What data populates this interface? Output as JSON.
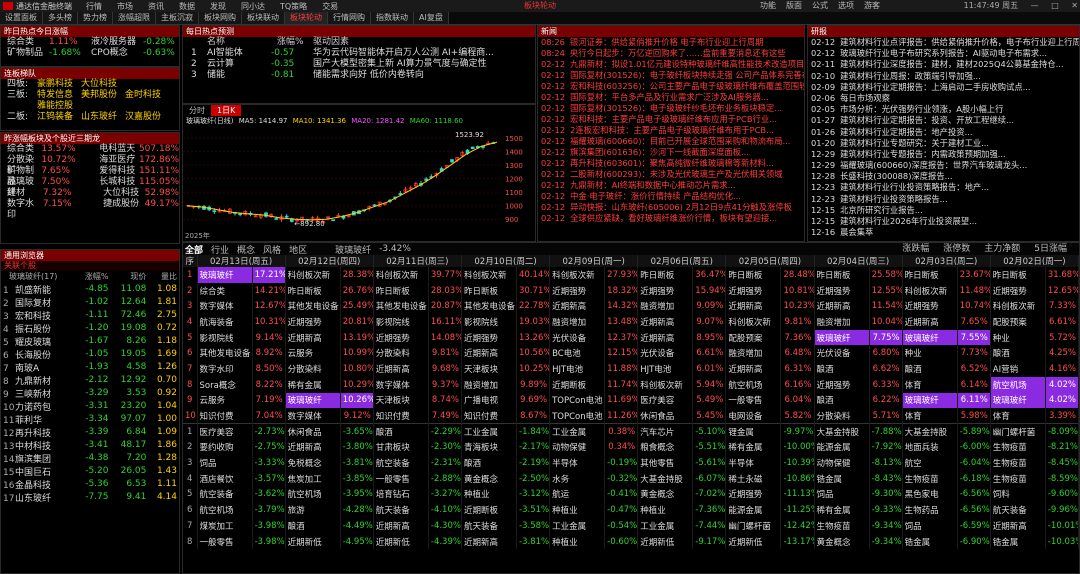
{
  "titlebar": {
    "app": "通达信金融终端",
    "menu": [
      "行情",
      "市场",
      "资讯",
      "数据",
      "发现",
      "同小达",
      "TQ策略",
      "交易"
    ],
    "center": "板块轮动",
    "right": [
      "功能",
      "版面",
      "公式",
      "选项",
      "游客"
    ],
    "time": "11:47:49 周五"
  },
  "tabs": [
    "设置面板",
    "多头榜",
    "势力榜",
    "涨幅超限",
    "主板沉寂",
    "板块网购",
    "板块联动",
    "板块轮动",
    "行情网购",
    "指数联动",
    "AI复盘"
  ],
  "active_tab": "板块轮动",
  "hot": {
    "title": "昨日热点今日涨幅",
    "rows": [
      [
        "综合类",
        "1.11%",
        "液冷服务器",
        "-0.28%"
      ],
      [
        "矿物制品",
        "-1.68%",
        "CPO概念",
        "-0.63%"
      ]
    ]
  },
  "conc": {
    "title": "连板梯队",
    "rows": [
      [
        "四板:",
        "豪鹏科技",
        "大位科技",
        ""
      ],
      [
        "三板:",
        "特发信息",
        "美邦股份",
        "金时科技"
      ],
      [
        "",
        "雅能控股",
        "",
        ""
      ],
      [
        "二板:",
        "江钨装备",
        "山东玻纤",
        "汉嘉股份"
      ]
    ]
  },
  "dragon": {
    "title": "昨涨幅板块及个股近三期龙",
    "rows": [
      [
        "综合类",
        "13.57%",
        "电科蓝天",
        "507.18%"
      ],
      [
        "分散染料",
        "10.72%",
        "海亚医疗",
        "172.86%"
      ],
      [
        "矿物制品",
        "7.65%",
        "爱得科技",
        "151.11%"
      ],
      [
        "玻璃玻纤",
        "7.50%",
        "长城科技",
        "115.05%"
      ],
      [
        "建材",
        "7.32%",
        "大位科技",
        "52.98%"
      ],
      [
        "数字水印",
        "7.15%",
        "捷成股份",
        "49.17%"
      ]
    ]
  },
  "watch": {
    "title": "通用浏览器",
    "sub": "关联个股",
    "headers": [
      "玻璃玻纤(17)",
      "涨幅%",
      "现价",
      "量比"
    ],
    "rows": [
      [
        "1",
        "凯盛新能",
        "-4.85",
        "11.08",
        "1.08"
      ],
      [
        "2",
        "国际复材",
        "-1.02",
        "12.64",
        "1.81"
      ],
      [
        "3",
        "宏和科技",
        "-1.11",
        "72.46",
        "2.75"
      ],
      [
        "4",
        "振石股份",
        "-1.20",
        "19.08",
        "0.72"
      ],
      [
        "5",
        "耀皮玻璃",
        "-1.67",
        "8.26",
        "1.18"
      ],
      [
        "6",
        "长海股份",
        "-1.05",
        "19.05",
        "1.69"
      ],
      [
        "7",
        "南玻A",
        "-1.93",
        "4.58",
        "1.26"
      ],
      [
        "8",
        "九鼎新材",
        "-2.12",
        "12.92",
        "0.70"
      ],
      [
        "9",
        "三峡新材",
        "-3.29",
        "3.53",
        "0.92"
      ],
      [
        "10",
        "力诺药包",
        "-3.31",
        "23.20",
        "1.04"
      ],
      [
        "11",
        "菲利华",
        "-3.34",
        "97.07",
        "1.00"
      ],
      [
        "12",
        "再升科技",
        "-3.39",
        "6.84",
        "1.09"
      ],
      [
        "13",
        "中材科技",
        "-3.41",
        "48.17",
        "1.86"
      ],
      [
        "14",
        "旗滨集团",
        "-4.38",
        "7.20",
        "1.28"
      ],
      [
        "15",
        "中国巨石",
        "-5.20",
        "26.05",
        "1.43"
      ],
      [
        "16",
        "金晶科技",
        "-5.36",
        "6.53",
        "1.11"
      ],
      [
        "17",
        "山东玻纤",
        "-7.75",
        "9.41",
        "4.14"
      ]
    ]
  },
  "theme": {
    "title": "每日热点预测",
    "headers": [
      "名称",
      "涨幅%",
      "驱动因素"
    ],
    "rows": [
      [
        "1",
        "AI智能体",
        "-0.57",
        "华为云代码智能体开启万人公测 AI+编程商..."
      ],
      [
        "2",
        "云计算",
        "-0.35",
        "国产大模型密集上新 AI算力景气度与确定性"
      ],
      [
        "3",
        "储能",
        "-0.81",
        "储能需求向好 低价内卷转向"
      ]
    ]
  },
  "chart_tabs": [
    "分时",
    "1日K"
  ],
  "chart_legend": {
    "name": "玻璃玻纤(日线)",
    "ma5": "MA5: 1414.97",
    "ma10": "MA10: 1341.36",
    "ma20": "MA20: 1281.42",
    "ma60": "MA60: 1118.60"
  },
  "chart_data": {
    "type": "line",
    "title": "玻璃玻纤(日线)",
    "series": [
      {
        "name": "MA5",
        "values": [
          1000,
          990,
          970,
          950,
          940,
          930,
          910,
          900,
          895,
          900,
          920,
          950,
          990,
          1030,
          1090,
          1150,
          1220,
          1300,
          1380,
          1440,
          1470
        ]
      }
    ],
    "high_label": "1523.92",
    "low_label": "892.80",
    "yaxis": [
      "1500",
      "1400",
      "1300",
      "1200",
      "1100",
      "1000",
      "900"
    ],
    "xlabel": "2025年"
  },
  "news": {
    "title": "新闻",
    "rows": [
      [
        "08:26",
        "银河证券：供给紧俏推升价格 电子布行业迎上行周期"
      ],
      [
        "08:24",
        "央行今日起步：万亿逆回购来了……盘前重要消息还有这些"
      ],
      [
        "02-12",
        "九鼎新材：拟设1.01亿元建设特种玻璃纤维高性能技术改造项目"
      ],
      [
        "02-12",
        "国际复材(301526)：电子玻纤板块持续走强 公司产品体系完善布局积极拓展"
      ],
      [
        "02-12",
        "宏和科技(603256)：公司主要产品电子级玻璃纤维布覆盖范围较广..."
      ],
      [
        "02-12",
        "国际复材：平台多产品及行业需求广泛涉及AI服务器..."
      ],
      [
        "02-12",
        "国际复材(301526)：电子级玻纤纱毛坯布业务板块稳定..."
      ],
      [
        "02-12",
        "宏和科技：主要产品电子级玻璃纤维布应用于PCB行业..."
      ],
      [
        "02-12",
        "2连板宏和科技：主要产品电子级玻璃纤维布用于PCB..."
      ],
      [
        "02-12",
        "福耀玻璃(600660)：目前已开展全球范围采购和物流布局..."
      ],
      [
        "02-12",
        "旗滨集团(601636)：沙河下一线截面深度面板..."
      ],
      [
        "02-12",
        "再升科技(603601)：聚焦高纯微纤维玻璃棉等新材料..."
      ],
      [
        "02-12",
        "二股新材(600293)：未涉及光伏玻璃生产及光伏相关领域"
      ],
      [
        "02-12",
        "九鼎新材：AI终端和数据中心推动芯片需求..."
      ],
      [
        "02-12",
        "中金·电子玻纤：涨价行情持续 产品结构优化..."
      ],
      [
        "02-12",
        "异动快报：山东玻纤(605006) 2月12日9点41分触及涨停板"
      ],
      [
        "02-12",
        "全球供应紧缺，看好玻璃纤维涨价行情，板块有望迎接..."
      ]
    ]
  },
  "fast": {
    "title": "研报",
    "rows": [
      [
        "02-12",
        "建筑材料行业点评报告：供给紧俏推升价格，电子布行业迎上行周期"
      ],
      [
        "02-12",
        "玻璃玻纤行业电子布研究系列报告：AI驱动电子布需求..."
      ],
      [
        "02-11",
        "建筑材料行业深度报告：建材，建材2025Q4公募基金持仓..."
      ],
      [
        "02-10",
        "建筑材料行业周报：政策端引导加强..."
      ],
      [
        "02-09",
        "建筑材料行业定期报告：上海启动二手房收购试点..."
      ],
      [
        "02-06",
        "每日市场观察"
      ],
      [
        "02-05",
        "市场分析：光伏强势行业领涨，A股小幅上行"
      ],
      [
        "01-27",
        "建筑材料行业定期报告：投资、开放工程继续..."
      ],
      [
        "01-26",
        "建筑材料行业定期报告：地产投资..."
      ],
      [
        "01-20",
        "建筑材料行业专题研究：关于建材工业..."
      ],
      [
        "12-29",
        "建筑材料行业专题报告：内需政策预期加强..."
      ],
      [
        "12-29",
        "福耀玻璃(600660)深度报告：世界汽车玻璃龙头..."
      ],
      [
        "12-28",
        "长盛科技(300088)深度报告..."
      ],
      [
        "12-23",
        "建筑材料行业行业投资策略报告：地产..."
      ],
      [
        "12-23",
        "建筑材料行业投资策略报告..."
      ],
      [
        "12-15",
        "北京所研究行业报告..."
      ],
      [
        "12-15",
        "建筑材料行业2026年行业投资展望..."
      ],
      [
        "12-16",
        "晨会集萃"
      ]
    ]
  },
  "grid": {
    "filters": [
      "全部",
      "行业",
      "概念",
      "风格",
      "地区"
    ],
    "selected": "玻璃玻纤",
    "selected_change": "-3.42%",
    "right": [
      "涨跌幅",
      "涨停数",
      "主力净额",
      "5日涨幅"
    ],
    "dates": [
      "02月13日(周五)",
      "02月12日(周四)",
      "02月11日(周三)",
      "02月10日(周二)",
      "02月09日(周一)",
      "02月06日(周五)",
      "02月05日(周四)",
      "02月04日(周三)",
      "02月03日(周二)",
      "02月02日(周一)"
    ],
    "rows": [
      [
        [
          "玻璃玻纤",
          "17.21%"
        ],
        [
          "科创板次新",
          "28.38%"
        ],
        [
          "科创板次新",
          "39.77%"
        ],
        [
          "科创板次新",
          "40.14%"
        ],
        [
          "科创板次新",
          "27.93%"
        ],
        [
          "昨日断板",
          "36.47%"
        ],
        [
          "昨日断板",
          "28.48%"
        ],
        [
          "昨日断板",
          "25.58%"
        ],
        [
          "昨日断板",
          "23.67%"
        ],
        [
          "昨日断板",
          "31.68%"
        ]
      ],
      [
        [
          "综合类",
          "14.21%"
        ],
        [
          "昨日断板",
          "26.76%"
        ],
        [
          "昨日断板",
          "28.03%"
        ],
        [
          "昨日断板",
          "30.71%"
        ],
        [
          "近期强势",
          "18.32%"
        ],
        [
          "近期强势",
          "15.94%"
        ],
        [
          "近期强势",
          "10.81%"
        ],
        [
          "近期强势",
          "12.55%"
        ],
        [
          "科创板次新",
          "11.48%"
        ],
        [
          "近期强势",
          "12.65%"
        ]
      ],
      [
        [
          "数字媒体",
          "12.67%"
        ],
        [
          "其他发电设备",
          "25.49%"
        ],
        [
          "其他发电设备",
          "20.87%"
        ],
        [
          "其他发电设备",
          "22.78%"
        ],
        [
          "近期新高",
          "14.32%"
        ],
        [
          "融资增加",
          "9.09%"
        ],
        [
          "近期新高",
          "10.23%"
        ],
        [
          "近期新高",
          "11.54%"
        ],
        [
          "近期强势",
          "10.74%"
        ],
        [
          "科创板次新",
          "7.33%"
        ]
      ],
      [
        [
          "航海装备",
          "10.31%"
        ],
        [
          "近期强势",
          "20.81%"
        ],
        [
          "影视院线",
          "16.11%"
        ],
        [
          "影视院线",
          "19.03%"
        ],
        [
          "融资增加",
          "13.48%"
        ],
        [
          "近期新高",
          "9.07%"
        ],
        [
          "科创板次新",
          "9.81%"
        ],
        [
          "融资增加",
          "10.04%"
        ],
        [
          "近期新高",
          "7.65%"
        ],
        [
          "配股预案",
          "6.61%"
        ]
      ],
      [
        [
          "影视院线",
          "9.14%"
        ],
        [
          "近期新高",
          "13.19%"
        ],
        [
          "近期强势",
          "14.08%"
        ],
        [
          "近期强势",
          "13.26%"
        ],
        [
          "光伏设备",
          "12.37%"
        ],
        [
          "近期新高",
          "8.95%"
        ],
        [
          "配股预案",
          "7.36%"
        ],
        [
          "玻璃玻纤",
          "7.75%"
        ],
        [
          "玻璃玻纤",
          "7.55%"
        ],
        [
          "种业",
          "5.72%"
        ]
      ],
      [
        [
          "其他发电设备",
          "8.92%"
        ],
        [
          "云服务",
          "10.99%"
        ],
        [
          "分散染料",
          "9.81%"
        ],
        [
          "近期新高",
          "10.56%"
        ],
        [
          "BC电池",
          "12.15%"
        ],
        [
          "光伏设备",
          "6.61%"
        ],
        [
          "融资增加",
          "6.48%"
        ],
        [
          "光伏设备",
          "6.80%"
        ],
        [
          "种业",
          "7.73%"
        ],
        [
          "酿酒",
          "4.25%"
        ]
      ],
      [
        [
          "数字水印",
          "8.50%"
        ],
        [
          "分散染料",
          "10.80%"
        ],
        [
          "近期新高",
          "9.68%"
        ],
        [
          "天津板块",
          "10.25%"
        ],
        [
          "HJT电池",
          "11.88%"
        ],
        [
          "HJT电池",
          "6.01%"
        ],
        [
          "近期新高",
          "6.31%"
        ],
        [
          "酿酒",
          "6.62%"
        ],
        [
          "酿酒",
          "6.52%"
        ],
        [
          "AI营销",
          "4.16%"
        ]
      ],
      [
        [
          "Sora概念",
          "8.22%"
        ],
        [
          "稀有金属",
          "10.29%"
        ],
        [
          "数字媒体",
          "9.37%"
        ],
        [
          "融资增加",
          "9.89%"
        ],
        [
          "近期断板",
          "11.74%"
        ],
        [
          "科创板次新",
          "5.94%"
        ],
        [
          "航空机场",
          "6.16%"
        ],
        [
          "近期强势",
          "6.33%"
        ],
        [
          "体育",
          "6.14%"
        ],
        [
          "航空机场",
          "4.02%"
        ]
      ],
      [
        [
          "云服务",
          "7.19%"
        ],
        [
          "玻璃玻纤",
          "10.26%"
        ],
        [
          "天津板块",
          "8.74%"
        ],
        [
          "广播电视",
          "9.69%"
        ],
        [
          "TOPCon电池",
          "11.69%"
        ],
        [
          "医疗美容",
          "5.49%"
        ],
        [
          "一般零售",
          "6.04%"
        ],
        [
          "酿酒",
          "6.22%"
        ],
        [
          "玻璃玻纤",
          "6.11%"
        ],
        [
          "玻璃玻纤",
          "4.02%"
        ]
      ],
      [
        [
          "知识付费",
          "7.04%"
        ],
        [
          "数字媒体",
          "9.12%"
        ],
        [
          "知识付费",
          "7.49%"
        ],
        [
          "知识付费",
          "8.67%"
        ],
        [
          "TOPCon电池",
          "11.26%"
        ],
        [
          "休闲食品",
          "5.45%"
        ],
        [
          "电网设备",
          "5.82%"
        ],
        [
          "分散染料",
          "5.71%"
        ],
        [
          "体育",
          "5.98%"
        ],
        [
          "体育",
          "3.39%"
        ]
      ],
      [
        [
          "医疗美容",
          "-2.73%"
        ],
        [
          "休闲食品",
          "-3.65%"
        ],
        [
          "酿酒",
          "-2.29%"
        ],
        [
          "工业金属",
          "-1.84%"
        ],
        [
          "工业金属",
          "0.38%"
        ],
        [
          "汽车芯片",
          "-5.10%"
        ],
        [
          "锂金属",
          "-9.97%"
        ],
        [
          "大基金持股",
          "-7.88%"
        ],
        [
          "大基金持股",
          "-5.89%"
        ],
        [
          "幽门螺杆菌",
          "-8.09%"
        ]
      ],
      [
        [
          "要约收购",
          "-2.75%"
        ],
        [
          "近期新高",
          "-3.80%"
        ],
        [
          "甘肃板块",
          "-2.30%"
        ],
        [
          "青海板块",
          "-2.17%"
        ],
        [
          "动物保健",
          "0.34%"
        ],
        [
          "粮食概念",
          "-5.51%"
        ],
        [
          "稀有金属",
          "-10.00%"
        ],
        [
          "能源金属",
          "-7.92%"
        ],
        [
          "地面兵装",
          "-6.00%"
        ],
        [
          "生物疫苗",
          "-8.21%"
        ]
      ],
      [
        [
          "饲品",
          "-3.33%"
        ],
        [
          "免税概念",
          "-3.81%"
        ],
        [
          "航空装备",
          "-2.31%"
        ],
        [
          "酿酒",
          "-2.19%"
        ],
        [
          "半导体",
          "-0.19%"
        ],
        [
          "其他零售",
          "-5.61%"
        ],
        [
          "半导体",
          "-10.39%"
        ],
        [
          "动物保健",
          "-8.13%"
        ],
        [
          "航空",
          "-6.04%"
        ],
        [
          "生物疫苗",
          "-8.45%"
        ]
      ],
      [
        [
          "酒店餐饮",
          "-3.57%"
        ],
        [
          "焦炭加工",
          "-3.85%"
        ],
        [
          "一般零售",
          "-2.88%"
        ],
        [
          "黄金概念",
          "-2.50%"
        ],
        [
          "水务",
          "-0.32%"
        ],
        [
          "大基金持股",
          "-6.07%"
        ],
        [
          "稀土永磁",
          "-10.86%"
        ],
        [
          "锆金属",
          "-8.43%"
        ],
        [
          "生物疫苗",
          "-6.18%"
        ],
        [
          "生物疫苗",
          "-8.59%"
        ]
      ],
      [
        [
          "航空装备",
          "-3.62%"
        ],
        [
          "航空机场",
          "-3.95%"
        ],
        [
          "培育钻石",
          "-3.27%"
        ],
        [
          "种植业",
          "-3.12%"
        ],
        [
          "航运",
          "-0.41%"
        ],
        [
          "黄金概念",
          "-7.02%"
        ],
        [
          "近期强势",
          "-11.13%"
        ],
        [
          "饲品",
          "-9.30%"
        ],
        [
          "黑色家电",
          "-6.56%"
        ],
        [
          "饲料",
          "-9.60%"
        ]
      ],
      [
        [
          "航空机场",
          "-3.79%"
        ],
        [
          "旅游",
          "-4.28%"
        ],
        [
          "航天装备",
          "-4.10%"
        ],
        [
          "近期断板",
          "-3.51%"
        ],
        [
          "种植业",
          "-0.47%"
        ],
        [
          "种植业",
          "-7.36%"
        ],
        [
          "能源金属",
          "-11.25%"
        ],
        [
          "稀有金属",
          "-9.33%"
        ],
        [
          "生物药品",
          "-6.56%"
        ],
        [
          "航天装备",
          "-9.96%"
        ]
      ],
      [
        [
          "煤炭加工",
          "-3.98%"
        ],
        [
          "酿酒",
          "-4.49%"
        ],
        [
          "近期新高",
          "-4.30%"
        ],
        [
          "航天装备",
          "-3.58%"
        ],
        [
          "工业金属",
          "-0.54%"
        ],
        [
          "工业金属",
          "-7.44%"
        ],
        [
          "幽门螺杆菌",
          "-12.42%"
        ],
        [
          "生物疫苗",
          "-9.34%"
        ],
        [
          "饲品",
          "-6.59%"
        ],
        [
          "近期新高",
          "-10.01%"
        ]
      ],
      [
        [
          "一般零售",
          "-3.98%"
        ],
        [
          "近期新低",
          "-4.95%"
        ],
        [
          "近期新低",
          "-4.39%"
        ],
        [
          "近期新高",
          "-3.81%"
        ],
        [
          "种植业",
          "-0.60%"
        ],
        [
          "近期新低",
          "-9.17%"
        ],
        [
          "近期新低",
          "-13.17%"
        ],
        [
          "黄金概念",
          "-9.34%"
        ],
        [
          "锆金属",
          "-6.90%"
        ],
        [
          "锆金属",
          "-10.03%"
        ]
      ]
    ]
  },
  "highlights": [
    [
      0,
      0
    ],
    [
      8,
      1
    ],
    [
      4,
      7
    ],
    [
      4,
      8
    ],
    [
      8,
      8
    ],
    [
      8,
      9
    ],
    [
      7,
      9
    ]
  ],
  "colors": {
    "up": "#ff4d4d",
    "down": "#2fd32f",
    "highlight": "#8a2be2",
    "header": "#7a0000"
  }
}
